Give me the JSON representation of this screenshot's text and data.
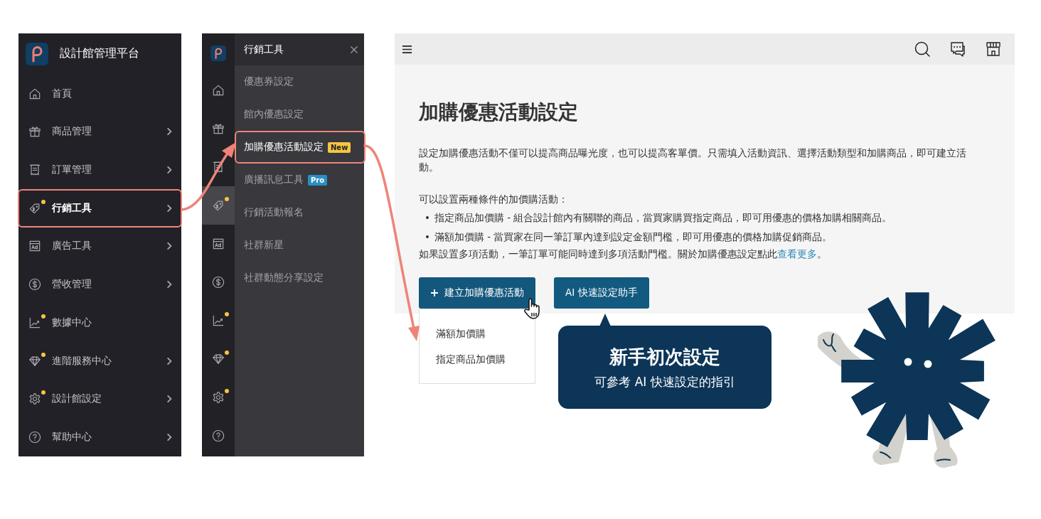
{
  "main_sidebar": {
    "title": "設計館管理平台",
    "items": [
      {
        "label": "首頁",
        "dot": false,
        "has_submenu": false,
        "selected": false
      },
      {
        "label": "商品管理",
        "dot": false,
        "has_submenu": true,
        "selected": false
      },
      {
        "label": "訂單管理",
        "dot": false,
        "has_submenu": true,
        "selected": false
      },
      {
        "label": "行銷工具",
        "dot": true,
        "has_submenu": true,
        "selected": true
      },
      {
        "label": "廣告工具",
        "dot": false,
        "has_submenu": true,
        "selected": false
      },
      {
        "label": "營收管理",
        "dot": false,
        "has_submenu": true,
        "selected": false
      },
      {
        "label": "數據中心",
        "dot": true,
        "has_submenu": false,
        "selected": false
      },
      {
        "label": "進階服務中心",
        "dot": true,
        "has_submenu": true,
        "selected": false
      },
      {
        "label": "設計館設定",
        "dot": true,
        "has_submenu": true,
        "selected": false
      },
      {
        "label": "幫助中心",
        "dot": false,
        "has_submenu": true,
        "selected": false
      }
    ]
  },
  "submenu": {
    "rail": [
      {
        "dot": false,
        "selected": false
      },
      {
        "dot": false,
        "selected": false
      },
      {
        "dot": false,
        "selected": false
      },
      {
        "dot": true,
        "selected": true
      },
      {
        "dot": false,
        "selected": false
      },
      {
        "dot": false,
        "selected": false
      },
      {
        "dot": true,
        "selected": false
      },
      {
        "dot": true,
        "selected": false
      },
      {
        "dot": true,
        "selected": false
      },
      {
        "dot": false,
        "selected": false
      }
    ],
    "title": "行銷工具",
    "items": [
      {
        "label": "優惠券設定",
        "selected": false
      },
      {
        "label": "館內優惠設定",
        "selected": false
      },
      {
        "label": "加購優惠活動設定",
        "selected": true,
        "badge": {
          "text": "New",
          "kind": "new"
        }
      },
      {
        "label": "廣播訊息工具",
        "selected": false,
        "badge": {
          "text": "Pro",
          "kind": "pro"
        }
      },
      {
        "label": "行銷活動報名",
        "selected": false
      },
      {
        "label": "社群新星",
        "selected": false
      },
      {
        "label": "社群動態分享設定",
        "selected": false
      }
    ]
  },
  "page": {
    "title": "加購優惠活動設定",
    "intro": "設定加購優惠活動不僅可以提高商品曝光度，也可以提高客單價。只需填入活動資訊、選擇活動類型和加購商品，即可建立活動。",
    "conditions_heading": "可以設置兩種條件的加價購活動：",
    "bullets": [
      {
        "marker": "•",
        "text": "指定商品加價購 - 組合設計館內有關聯的商品，當買家購買指定商品，即可用優惠的價格加購相關商品。"
      },
      {
        "marker": "•",
        "text": "滿額加價購 - 當買家在同一筆訂單內達到設定金額門檻，即可用優惠的價格加購促銷商品。"
      }
    ],
    "note": "如果設置多項活動，一筆訂單可能同時達到多項活動門檻。關於加購優惠設定點此",
    "note_link": "查看更多",
    "note_end": "。",
    "buttons": [
      {
        "label": "建立加購優惠活動",
        "kind": "create"
      },
      {
        "label": "AI 快速設定助手",
        "kind": "ai"
      }
    ],
    "dropdown": [
      "滿額加價購",
      "指定商品加價購"
    ]
  },
  "callout": {
    "title": "新手初次設定",
    "subtitle": "可參考 AI 快速設定的指引"
  }
}
